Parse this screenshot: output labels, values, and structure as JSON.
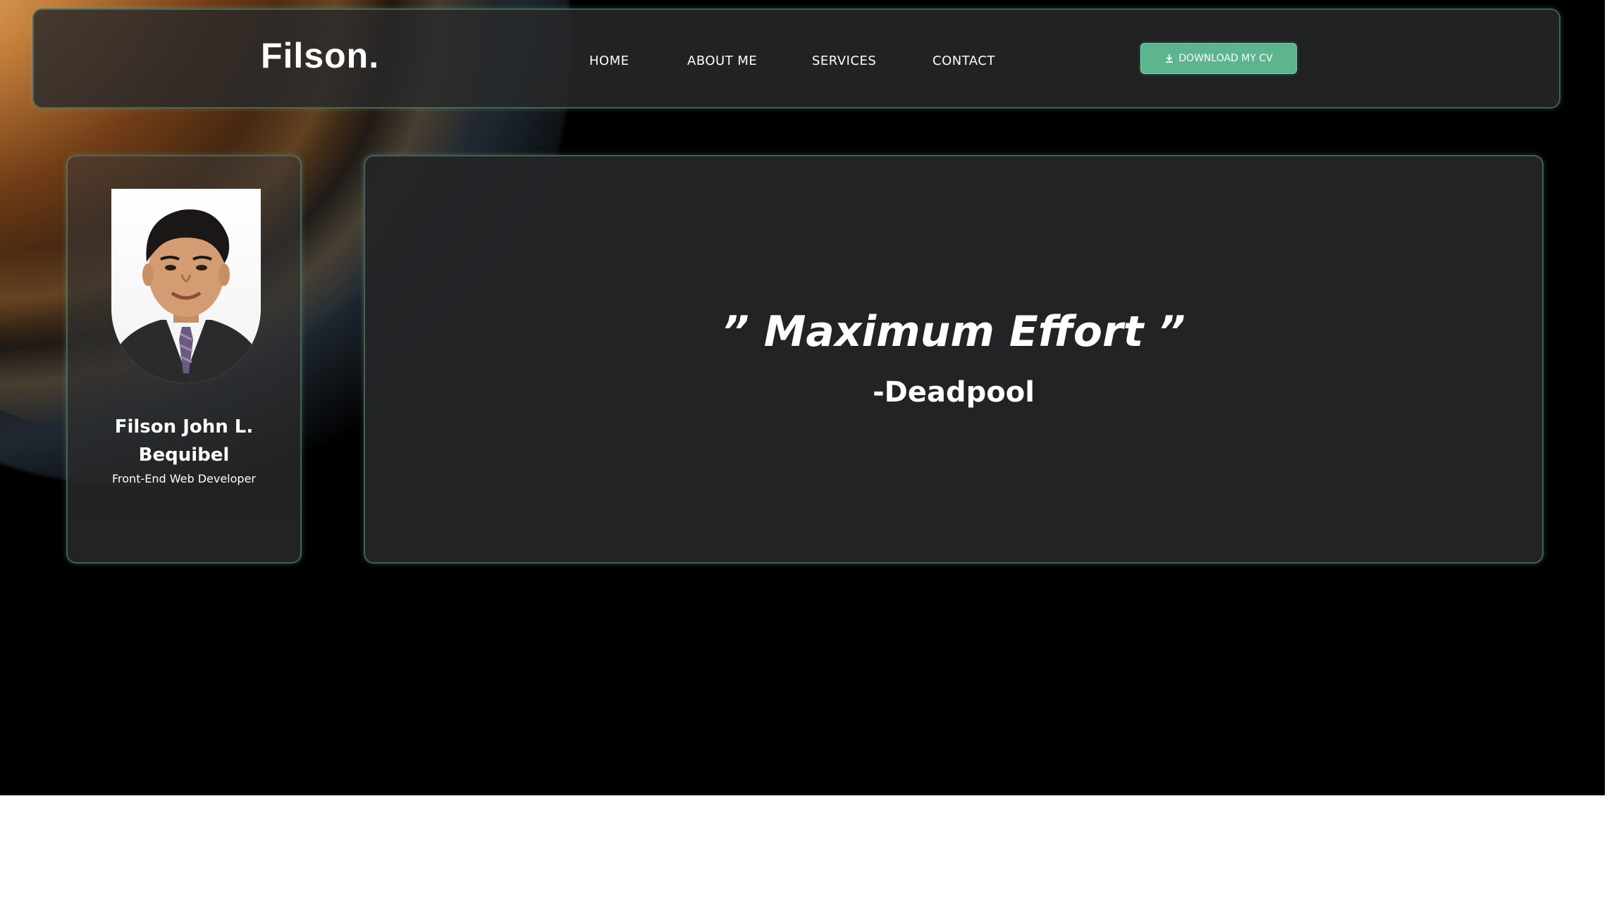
{
  "header": {
    "logo": "Filson.",
    "nav": [
      {
        "label": "HOME"
      },
      {
        "label": "ABOUT ME"
      },
      {
        "label": "SERVICES"
      },
      {
        "label": "CONTACT"
      }
    ],
    "cv_button": {
      "label": "DOWNLOAD MY CV",
      "icon": "download-icon"
    }
  },
  "profile": {
    "name": "Filson John L. Bequibel",
    "role": "Front-End Web Developer",
    "photo_alt": "avatar"
  },
  "quote": {
    "text": "” Maximum Effort ”",
    "author": "-Deadpool"
  },
  "colors": {
    "background": "#000000",
    "panel": "#28292b",
    "accent": "#5cb58e",
    "border": "#6eaa8c",
    "text": "#ffffff"
  }
}
